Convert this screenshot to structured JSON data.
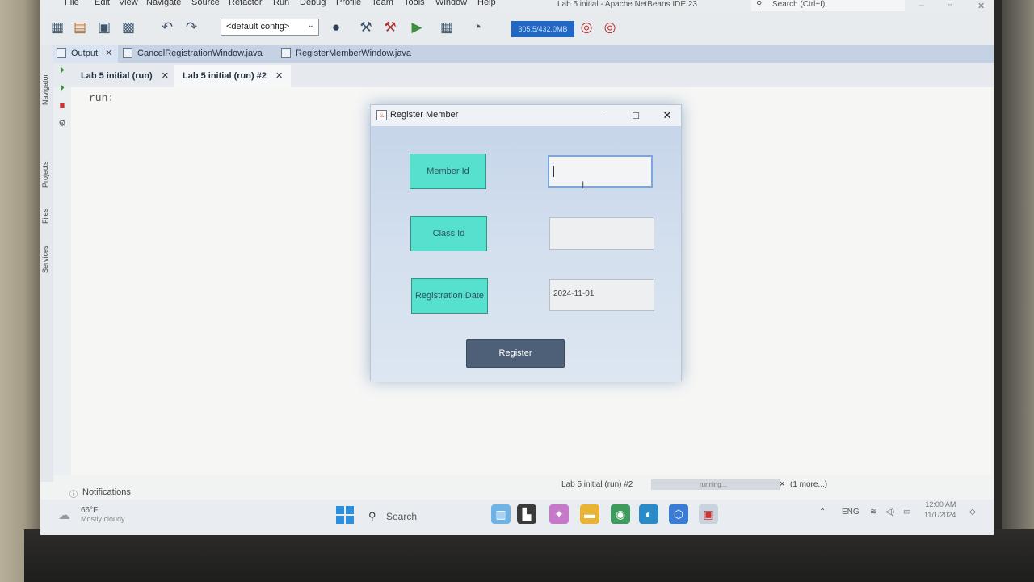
{
  "ide": {
    "menu": [
      "File",
      "Edit",
      "View",
      "Navigate",
      "Source",
      "Refactor",
      "Run",
      "Debug",
      "Profile",
      "Team",
      "Tools",
      "Window",
      "Help"
    ],
    "window_title": "Lab 5 initial - Apache NetBeans IDE 23",
    "search_placeholder": "Search (Ctrl+I)",
    "config_value": "<default config>",
    "memory": "305.5/432.0MB"
  },
  "sidebar_tabs": [
    "Navigator",
    "Projects",
    "Files",
    "Services"
  ],
  "editor_tabs": [
    {
      "label": "Output",
      "active": true
    },
    {
      "label": "CancelRegistrationWindow.java",
      "active": false
    },
    {
      "label": "RegisterMemberWindow.java",
      "active": false
    }
  ],
  "output_tabs": [
    {
      "label": "Lab 5 initial (run)",
      "active": false
    },
    {
      "label": "Lab 5 initial (run) #2",
      "active": true
    }
  ],
  "output": {
    "text": "run:"
  },
  "status": {
    "notifications": "Notifications",
    "task": "Lab 5 initial (run) #2",
    "progress_text": "running...",
    "more": "(1 more...)"
  },
  "dialog": {
    "title": "Register Member",
    "labels": {
      "member_id": "Member Id",
      "class_id": "Class Id",
      "registration_date": "Registration Date"
    },
    "values": {
      "member_id": "",
      "class_id": "",
      "registration_date": "2024-11-01"
    },
    "button": "Register"
  },
  "taskbar": {
    "weather_temp": "66°F",
    "weather_desc": "Mostly cloudy",
    "search": "Search",
    "lang": "ENG",
    "time": "12:00 AM",
    "date": "11/1/2024"
  }
}
